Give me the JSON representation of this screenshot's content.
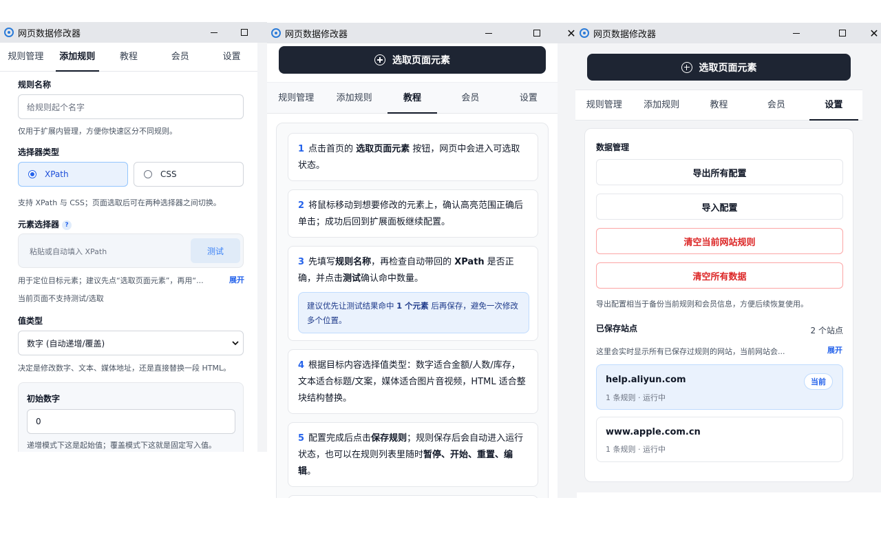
{
  "app": {
    "title": "网页数据修改器"
  },
  "tabs": [
    "规则管理",
    "添加规则",
    "教程",
    "会员",
    "设置"
  ],
  "select_button": "选取页面元素",
  "add_rule": {
    "name_label": "规则名称",
    "name_placeholder": "给规则起个名字",
    "name_hint": "仅用于扩展内管理，方便你快速区分不同规则。",
    "selector_type_label": "选择器类型",
    "selector_options": [
      "XPath",
      "CSS"
    ],
    "selector_selected": "XPath",
    "selector_hint": "支持 XPath 与 CSS；页面选取后可在两种选择器之间切换。",
    "element_selector_label": "元素选择器",
    "help_glyph": "?",
    "element_placeholder": "粘贴或自动填入 XPath",
    "test_button": "测试",
    "element_hint": "用于定位目标元素；建议先点“选取页面元素”，再用“...",
    "expand_link": "展开",
    "unsupported_hint": "当前页面不支持测试/选取",
    "value_type_label": "值类型",
    "value_type_selected": "数字 (自动递增/覆盖)",
    "value_type_hint": "决定是修改数字、文本、媒体地址，还是直接替换一段 HTML。",
    "initial_label": "初始数字",
    "initial_value": "0",
    "initial_hint": "递增模式下这是起始值；覆盖模式下这就是固定写入值。"
  },
  "tutorial": {
    "steps": [
      {
        "num": "1",
        "parts": [
          "点击首页的 ",
          "选取页面元素",
          " 按钮，网页中会进入可选取状态。"
        ]
      },
      {
        "num": "2",
        "parts": [
          "将鼠标移动到想要修改的元素上，确认高亮范围正确后单击；成功后回到扩展面板继续配置。"
        ]
      },
      {
        "num": "3",
        "parts": [
          "先填写",
          "规则名称",
          "，再检查自动带回的 ",
          "XPath",
          " 是否正确，并点击",
          "测试",
          "确认命中数量。"
        ],
        "tip": [
          "建议优先让测试结果命中 ",
          "1 个元素",
          " 后再保存，避免一次修改多个位置。"
        ]
      },
      {
        "num": "4",
        "parts": [
          "根据目标内容选择值类型：数字适合金额/人数/库存，文本适合标题/文案，媒体适合图片音视频，HTML 适合整块结构替换。"
        ]
      },
      {
        "num": "5",
        "parts": [
          "配置完成后点击",
          "保存规则",
          "；规则保存后会自动进入运行状态，也可以在规则列表里随时",
          "暂停、开始、重置、编辑",
          "。"
        ]
      }
    ]
  },
  "settings": {
    "data_mgmt_label": "数据管理",
    "export_button": "导出所有配置",
    "import_button": "导入配置",
    "clear_site_button": "清空当前网站规则",
    "clear_all_button": "清空所有数据",
    "export_hint": "导出配置相当于备份当前规则和会员信息，方便后续恢复使用。",
    "saved_sites_label": "已保存站点",
    "saved_sites_count": "2 个站点",
    "saved_sites_hint": "这里会实时显示所有已保存过规则的网站，当前网站会...",
    "expand_link": "展开",
    "sites": [
      {
        "domain": "help.aliyun.com",
        "meta": "1 条规则 · 运行中",
        "badge": "当前"
      },
      {
        "domain": "www.apple.com.cn",
        "meta": "1 条规则 · 运行中",
        "badge": ""
      }
    ]
  },
  "colors": {
    "accent": "#2563eb",
    "dark": "#1e2533",
    "danger": "#dc2626"
  }
}
